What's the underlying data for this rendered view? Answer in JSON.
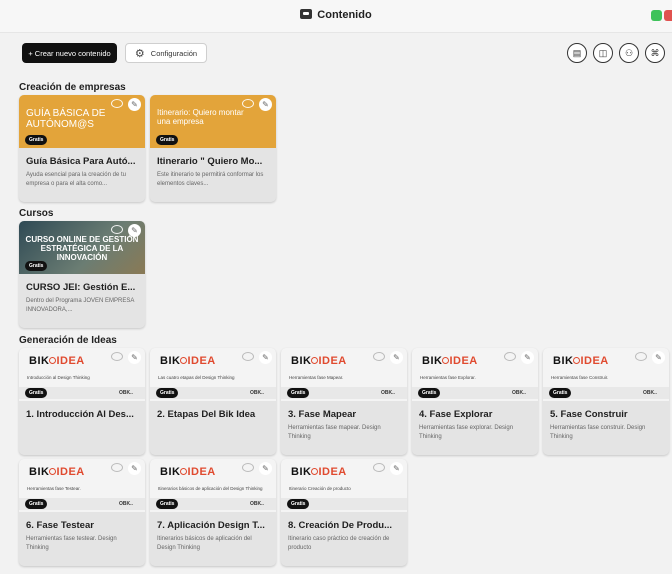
{
  "window": {
    "title": "Contenido"
  },
  "toolbar": {
    "create_label": "+ Crear nuevo contenido",
    "config_label": "Configuración",
    "right_icons": [
      "document-icon",
      "book-icon",
      "users-icon",
      "sitemap-icon"
    ]
  },
  "sections": [
    {
      "title": "Creación de empresas",
      "cards": [
        {
          "thumb_style": "orange",
          "thumb_text": "GUÍA BÁSICA DE AUTÓNOM@S",
          "badge": "Gratis",
          "title": "Guía Básica Para Autó...",
          "description": "Ayuda esencial para la creación de tu empresa o para el alta como..."
        },
        {
          "thumb_style": "orange",
          "thumb_text": "Itinerario: Quiero montar una empresa",
          "badge": "Gratis",
          "title": "Itinerario \" Quiero Mo...",
          "description": "Este itinerario te permitirá conformar los elementos claves..."
        }
      ]
    },
    {
      "title": "Cursos",
      "cards": [
        {
          "thumb_style": "dark",
          "thumb_text": "CURSO ONLINE DE GESTIÓN ESTRATÉGICA DE LA INNOVACIÓN",
          "badge": "Gratis",
          "title": "CURSO JEI: Gestión E...",
          "description": "Dentro del Programa JOVEN EMPRESA INNOVADORA,..."
        }
      ]
    },
    {
      "title": "Generación de Ideas",
      "cards": [
        {
          "thumb_style": "bik",
          "logo_a": "BIK",
          "logo_b": "IDEA",
          "subtitle": "Introducción al Design Thinking",
          "badge": "Gratis",
          "strip_text": "OBK..",
          "title": "1. Introducción Al Des...",
          "description": ""
        },
        {
          "thumb_style": "bik",
          "logo_a": "BIK",
          "logo_b": "IDEA",
          "subtitle": "Las cuatro etapas del Design Thinking",
          "badge": "Gratis",
          "strip_text": "OBK..",
          "title": "2. Etapas Del Bik Idea",
          "description": ""
        },
        {
          "thumb_style": "bik",
          "logo_a": "BIK",
          "logo_b": "IDEA",
          "subtitle": "Herramientas fase Mapear.",
          "badge": "Gratis",
          "strip_text": "OBK..",
          "title": "3. Fase Mapear",
          "description": "Herramientas fase mapear. Design Thinking"
        },
        {
          "thumb_style": "bik",
          "logo_a": "BIK",
          "logo_b": "IDEA",
          "subtitle": "Herramientas fase Explorar.",
          "badge": "Gratis",
          "strip_text": "OBK..",
          "title": "4. Fase Explorar",
          "description": "Herramientas fase explorar. Design Thinking"
        },
        {
          "thumb_style": "bik",
          "logo_a": "BIK",
          "logo_b": "IDEA",
          "subtitle": "Herramientas fase Construir.",
          "badge": "Gratis",
          "strip_text": "OBK..",
          "title": "5. Fase Construir",
          "description": "Herramientas fase construir. Design Thinking"
        },
        {
          "thumb_style": "bik",
          "logo_a": "BIK",
          "logo_b": "IDEA",
          "subtitle": "Herramientas fase Testear.",
          "badge": "Gratis",
          "strip_text": "OBK..",
          "title": "6. Fase Testear",
          "description": "Herramientas fase testear. Design Thinking"
        },
        {
          "thumb_style": "bik",
          "logo_a": "BIK",
          "logo_b": "IDEA",
          "subtitle": "Itinerarios básicos de aplicación del Design Thinking",
          "badge": "Gratis",
          "strip_text": "OBK..",
          "title": "7. Aplicación Design T...",
          "description": "Itinerarios básicos de aplicación del Design Thinking"
        },
        {
          "thumb_style": "bik",
          "logo_a": "BIK",
          "logo_b": "IDEA",
          "subtitle": "Itinerario Creación de producto",
          "badge": "Gratis",
          "strip_text": "",
          "title": "8. Creación De Produ...",
          "description": "Itinerario caso práctico de creación de producto"
        }
      ]
    }
  ],
  "colors": {
    "orange_thumb": "#e3a43a",
    "bik_red": "#e04a2f",
    "primary_button": "#111111"
  }
}
